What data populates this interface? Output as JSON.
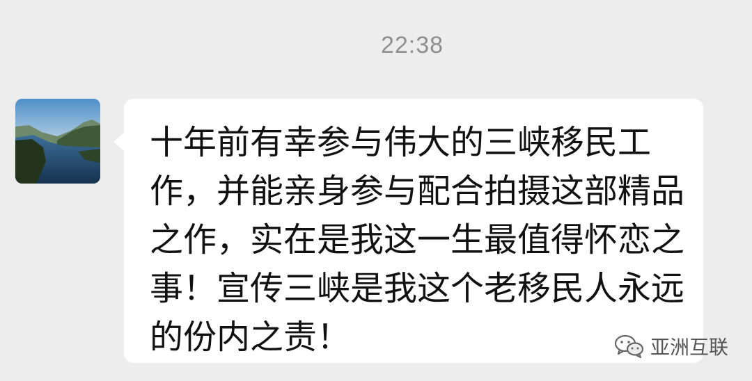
{
  "chat": {
    "timestamp": "22:38",
    "sender": {
      "avatar_icon": "landscape-avatar-icon"
    },
    "message": {
      "text": "十年前有幸参与伟大的三峡移民工作，并能亲身参与配合拍摄这部精品之作，实在是我这一生最值得怀恋之事！宣传三峡是我这个老移民人永远的份内之责！"
    }
  },
  "watermark": {
    "icon": "wechat-icon",
    "label": "亚洲互联"
  },
  "colors": {
    "background": "#ededed",
    "bubble": "#ffffff",
    "timestamp": "#8f8f8f",
    "text": "#111111"
  }
}
